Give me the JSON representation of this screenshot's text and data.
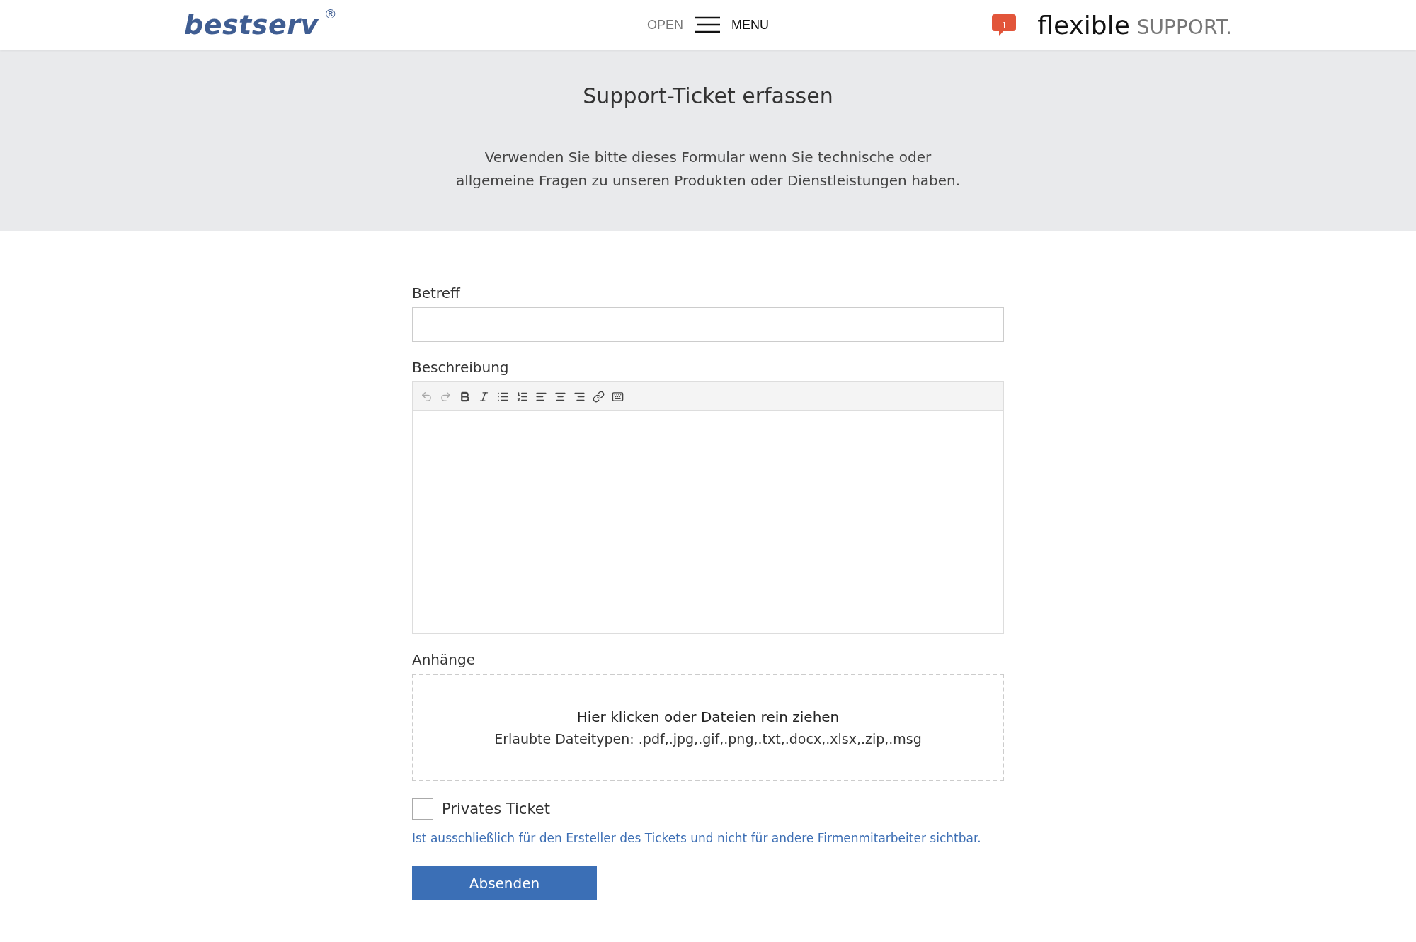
{
  "header": {
    "logo": "bestserv",
    "logo_mark": "®",
    "menu_open": "OPEN",
    "menu_label": "MENU",
    "notification_count": "1",
    "brand_main": "flexible",
    "brand_sub": "SUPPORT."
  },
  "hero": {
    "title": "Support-Ticket erfassen",
    "text_lines": [
      "Verwenden Sie bitte dieses Formular wenn Sie technische oder",
      "allgemeine Fragen zu unseren Produkten oder Dienstleistungen haben."
    ]
  },
  "form": {
    "subject": {
      "label": "Betreff"
    },
    "description": {
      "label": "Beschreibung",
      "toolbar": [
        {
          "kind": "undo",
          "disabled": true
        },
        {
          "kind": "redo",
          "disabled": true
        },
        {
          "kind": "bold",
          "disabled": false
        },
        {
          "kind": "italic",
          "disabled": false
        },
        {
          "kind": "bullets",
          "disabled": false
        },
        {
          "kind": "numbers",
          "disabled": false
        },
        {
          "kind": "left",
          "disabled": false
        },
        {
          "kind": "center",
          "disabled": false
        },
        {
          "kind": "right",
          "disabled": false
        },
        {
          "kind": "link",
          "disabled": false
        },
        {
          "kind": "keyboard",
          "disabled": false
        }
      ]
    },
    "attachments": {
      "label": "Anhänge",
      "drop_title": "Hier klicken oder Dateien rein ziehen",
      "drop_hint": "Erlaubte Dateitypen: .pdf,.jpg,.gif,.png,.txt,.docx,.xlsx,.zip,.msg"
    },
    "private": {
      "label": "Privates Ticket",
      "checked": false,
      "hint": "Ist ausschließlich für den Ersteller des Tickets und nicht für andere Firmenmitarbeiter sichtbar."
    },
    "submit": "Absenden"
  }
}
